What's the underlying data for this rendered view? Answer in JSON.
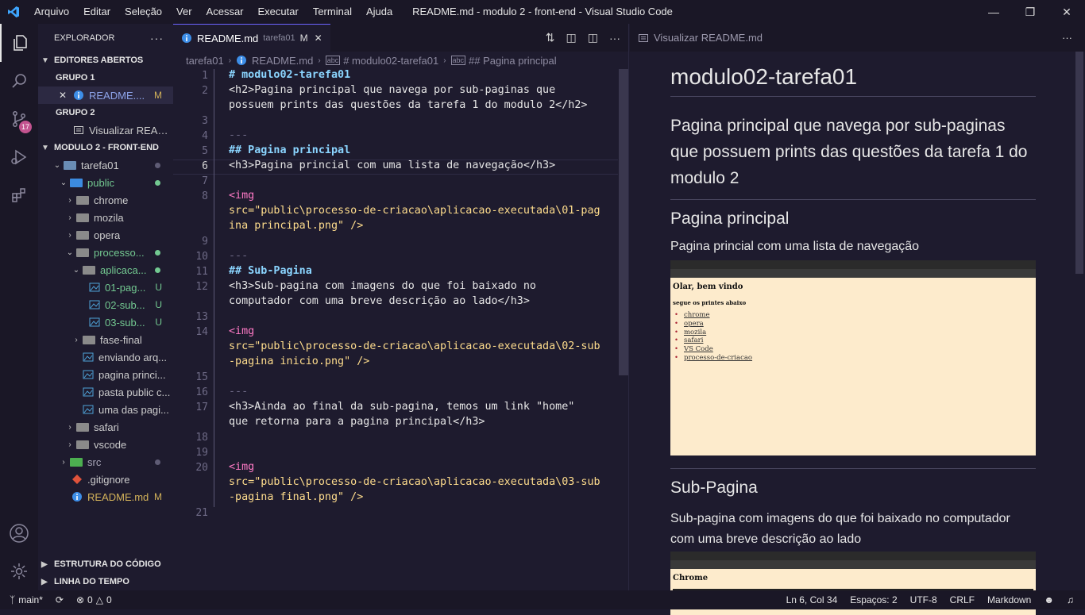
{
  "window": {
    "title": "README.md - modulo 2 - front-end - Visual Studio Code",
    "menu": [
      "Arquivo",
      "Editar",
      "Seleção",
      "Ver",
      "Acessar",
      "Executar",
      "Terminal",
      "Ajuda"
    ]
  },
  "activity": {
    "source_control_badge": "17"
  },
  "sidebar": {
    "title": "EXPLORADOR",
    "open_editors": {
      "header": "EDITORES ABERTOS",
      "groups": [
        {
          "label": "GRUPO 1",
          "file": "README....",
          "status": "M"
        },
        {
          "label": "GRUPO 2",
          "file": "Visualizar READ..."
        }
      ]
    },
    "workspace": {
      "header": "MODULO 2 - FRONT-END",
      "items": [
        {
          "label": "tarefa01"
        },
        {
          "label": "public"
        },
        {
          "label": "chrome"
        },
        {
          "label": "mozila"
        },
        {
          "label": "opera"
        },
        {
          "label": "processo..."
        },
        {
          "label": "aplicaca..."
        },
        {
          "label": "01-pag...",
          "status": "U"
        },
        {
          "label": "02-sub...",
          "status": "U"
        },
        {
          "label": "03-sub...",
          "status": "U"
        },
        {
          "label": "fase-final"
        },
        {
          "label": "enviando arq..."
        },
        {
          "label": "pagina princi..."
        },
        {
          "label": "pasta public c..."
        },
        {
          "label": "uma das pagi..."
        },
        {
          "label": "safari"
        },
        {
          "label": "vscode"
        },
        {
          "label": "src"
        },
        {
          "label": ".gitignore"
        },
        {
          "label": "README.md",
          "status": "M"
        }
      ]
    },
    "outline": "ESTRUTURA DO CÓDIGO",
    "timeline": "LINHA DO TEMPO"
  },
  "editor": {
    "tab": {
      "label": "README.md",
      "path": "tarefa01",
      "status": "M"
    },
    "breadcrumb": [
      "tarefa01",
      "README.md",
      "# modulo02-tarefa01",
      "## Pagina principal"
    ],
    "lines": {
      "l1": "# modulo02-tarefa01",
      "l2a": "<h2>Pagina principal que navega por sub-paginas que",
      "l2b": "possuem prints das questões da tarefa 1 do modulo 2</h2>",
      "l4": "---",
      "l5": "## Pagina principal",
      "l6": "<h3>Pagina princial com uma lista de navegação</h3>",
      "l8": "<img",
      "l8b": "src=\"public\\processo-de-criacao\\aplicacao-executada\\01-pag",
      "l8c": "ina principal.png\" />",
      "l10": "---",
      "l11": "## Sub-Pagina",
      "l12a": "<h3>Sub-pagina com imagens do que foi baixado no",
      "l12b": "computador com uma breve descrição ao lado</h3>",
      "l14": "<img",
      "l14b": "src=\"public\\processo-de-criacao\\aplicacao-executada\\02-sub",
      "l14c": "-pagina inicio.png\" />",
      "l16": "---",
      "l17a": "<h3>Ainda ao final da sub-pagina, temos um link \"home\"",
      "l17b": "que retorna para a pagina principal</h3>",
      "l20": "<img",
      "l20b": "src=\"public\\processo-de-criacao\\aplicacao-executada\\03-sub",
      "l20c": "-pagina final.png\" />"
    },
    "line_numbers": [
      "1",
      "2",
      "3",
      "4",
      "5",
      "6",
      "7",
      "8",
      "9",
      "10",
      "11",
      "12",
      "13",
      "14",
      "15",
      "16",
      "17",
      "18",
      "19",
      "20",
      "21"
    ]
  },
  "preview": {
    "tab": "Visualizar README.md",
    "h1": "modulo02-tarefa01",
    "h2": "Pagina principal que navega por sub-paginas que possuem prints das questões da tarefa 1 do modulo 2",
    "sec1_title": "Pagina principal",
    "sec1_text": "Pagina princial com uma lista de navegação",
    "shot1": {
      "heading": "Olar, bem vindo",
      "sub": "segue os printes abaixo",
      "links": [
        "chrome",
        "opera",
        "mozila",
        "safari",
        "VS Code",
        "processo-de-criacao"
      ]
    },
    "sec2_title": "Sub-Pagina",
    "sec2_text": "Sub-pagina com imagens do que foi baixado no computador com uma breve descrição ao lado",
    "shot2": {
      "heading": "Chrome"
    }
  },
  "statusbar": {
    "branch": "main*",
    "problems": "0",
    "warnings": "0",
    "position": "Ln 6, Col 34",
    "spaces": "Espaços: 2",
    "encoding": "UTF-8",
    "eol": "CRLF",
    "language": "Markdown"
  },
  "colors": {
    "accent": "#6c63ff",
    "modified": "#d4b35a",
    "untracked": "#73c991"
  }
}
